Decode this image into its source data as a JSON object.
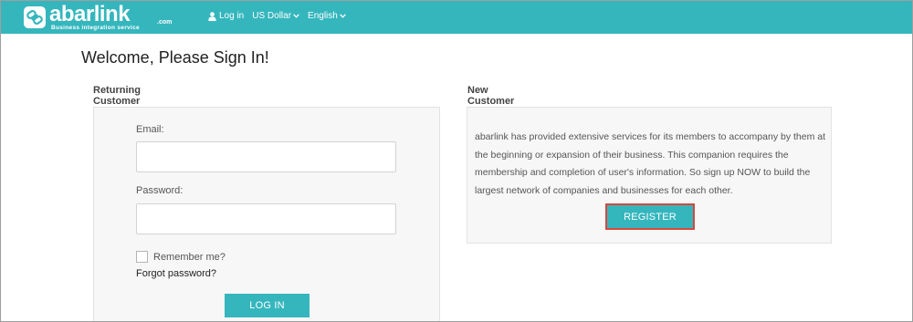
{
  "header": {
    "logo": {
      "brand": "abarlink",
      "domain": ".com",
      "tagline": "Business integration service"
    },
    "nav": {
      "login_label": "Log in",
      "currency_label": "US Dollar",
      "language_label": "English"
    }
  },
  "main": {
    "title": "Welcome, Please Sign In!",
    "returning": {
      "section_title": "Returning Customer",
      "email_label": "Email:",
      "email_value": "",
      "password_label": "Password:",
      "password_value": "",
      "remember_label": "Remember me?",
      "remember_checked": false,
      "forgot_label": "Forgot password?",
      "login_button": "LOG IN"
    },
    "new_customer": {
      "section_title": "New Customer",
      "description": "abarlink has provided extensive services for its members to accompany by them at the beginning or expansion of their business. This companion requires the membership and completion of user's information. So sign up NOW to build the largest network of companies and businesses for each other.",
      "register_button": "REGISTER"
    }
  },
  "colors": {
    "accent": "#35b6bd",
    "highlight_border": "#d9463e",
    "panel_bg": "#f7f7f7"
  },
  "icons": {
    "logo": "chain-link-icon",
    "login": "user-icon",
    "dropdown": "chevron-down-icon"
  }
}
